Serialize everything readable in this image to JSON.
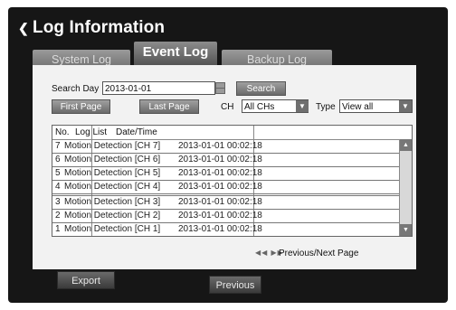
{
  "window": {
    "title": "Log Information"
  },
  "tabs": [
    {
      "label": "System Log"
    },
    {
      "label": "Event Log"
    },
    {
      "label": "Backup Log"
    }
  ],
  "search": {
    "day_label": "Search Day",
    "day_value": "2013-01-01",
    "search_button": "Search"
  },
  "nav": {
    "first_page": "First Page",
    "last_page": "Last Page",
    "ch_label": "CH",
    "ch_value": "All CHs",
    "type_label": "Type",
    "type_value": "View all"
  },
  "table": {
    "headers": {
      "no": "No.",
      "log": "Log List",
      "datetime": "Date/Time"
    },
    "rows": [
      {
        "no": "7",
        "log": "Motion Detection [CH 7]",
        "datetime": "2013-01-01 00:02:18"
      },
      {
        "no": "6",
        "log": "Motion Detection [CH 6]",
        "datetime": "2013-01-01 00:02:18"
      },
      {
        "no": "5",
        "log": "Motion Detection [CH 5]",
        "datetime": "2013-01-01 00:02:18"
      },
      {
        "no": "4",
        "log": "Motion Detection [CH 4]",
        "datetime": "2013-01-01 00:02:18"
      },
      {
        "no": "3",
        "log": "Motion Detection [CH 3]",
        "datetime": "2013-01-01 00:02:18"
      },
      {
        "no": "2",
        "log": "Motion Detection [CH 2]",
        "datetime": "2013-01-01 00:02:18"
      },
      {
        "no": "1",
        "log": "Motion Detection [CH 1]",
        "datetime": "2013-01-01 00:02:18"
      }
    ]
  },
  "pager": {
    "icon": "double-arrow-icon",
    "label": "Previous/Next Page"
  },
  "footer": {
    "export_button": "Export",
    "previous_button": "Previous"
  },
  "colors": {
    "frame": "#161616",
    "panel": "#f2f2f2",
    "tab": "#7a7a7a"
  }
}
